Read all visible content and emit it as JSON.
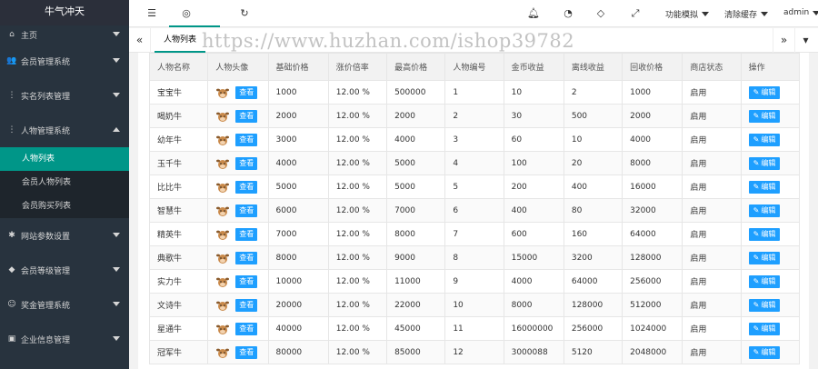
{
  "sidebar": {
    "brand": "牛气冲天",
    "items": [
      {
        "label": "主页",
        "icon": "home-icon",
        "glyph": "⌂"
      },
      {
        "label": "会员管理系统",
        "icon": "users-icon",
        "glyph": "👥"
      },
      {
        "label": "实名列表管理",
        "icon": "list-icon",
        "glyph": "⋮"
      },
      {
        "label": "人物管理系统",
        "icon": "list-icon",
        "glyph": "⋮"
      },
      {
        "label": "网站参数设置",
        "icon": "gear-icon",
        "glyph": "✱"
      },
      {
        "label": "会员等级管理",
        "icon": "diamond-icon",
        "glyph": "◆"
      },
      {
        "label": "奖金管理系统",
        "icon": "smile-icon",
        "glyph": "☺"
      },
      {
        "label": "企业信息管理",
        "icon": "document-icon",
        "glyph": "▣"
      }
    ],
    "sub_items": [
      "人物列表",
      "会员人物列表",
      "会员购买列表"
    ]
  },
  "topbar": {
    "menu_func": "功能模拟",
    "menu_cache": "清除缓存",
    "menu_user": "admin"
  },
  "tabs": {
    "active": "人物列表",
    "watermark": "https://www.huzhan.com/ishop39782"
  },
  "table": {
    "headers": [
      "人物名称",
      "人物头像",
      "基础价格",
      "涨价倍率",
      "最高价格",
      "人物编号",
      "金币收益",
      "离线收益",
      "回收价格",
      "商店状态",
      "操作"
    ],
    "view_label": "查看",
    "edit_label": "编辑",
    "rows": [
      {
        "name": "宝宝牛",
        "base": "1000",
        "rate": "12.00 %",
        "max": "500000",
        "no": "1",
        "gold": "10",
        "offline": "2",
        "recycle": "1000",
        "status": "启用"
      },
      {
        "name": "喝奶牛",
        "base": "2000",
        "rate": "12.00 %",
        "max": "2000",
        "no": "2",
        "gold": "30",
        "offline": "500",
        "recycle": "2000",
        "status": "启用"
      },
      {
        "name": "幼年牛",
        "base": "3000",
        "rate": "12.00 %",
        "max": "4000",
        "no": "3",
        "gold": "60",
        "offline": "10",
        "recycle": "4000",
        "status": "启用"
      },
      {
        "name": "玉千牛",
        "base": "4000",
        "rate": "12.00 %",
        "max": "5000",
        "no": "4",
        "gold": "100",
        "offline": "20",
        "recycle": "8000",
        "status": "启用"
      },
      {
        "name": "比比牛",
        "base": "5000",
        "rate": "12.00 %",
        "max": "5000",
        "no": "5",
        "gold": "200",
        "offline": "400",
        "recycle": "16000",
        "status": "启用"
      },
      {
        "name": "智慧牛",
        "base": "6000",
        "rate": "12.00 %",
        "max": "7000",
        "no": "6",
        "gold": "400",
        "offline": "80",
        "recycle": "32000",
        "status": "启用"
      },
      {
        "name": "精英牛",
        "base": "7000",
        "rate": "12.00 %",
        "max": "8000",
        "no": "7",
        "gold": "600",
        "offline": "160",
        "recycle": "64000",
        "status": "启用"
      },
      {
        "name": "典歌牛",
        "base": "8000",
        "rate": "12.00 %",
        "max": "9000",
        "no": "8",
        "gold": "15000",
        "offline": "3200",
        "recycle": "128000",
        "status": "启用"
      },
      {
        "name": "实力牛",
        "base": "10000",
        "rate": "12.00 %",
        "max": "11000",
        "no": "9",
        "gold": "4000",
        "offline": "64000",
        "recycle": "256000",
        "status": "启用"
      },
      {
        "name": "文诗牛",
        "base": "20000",
        "rate": "12.00 %",
        "max": "22000",
        "no": "10",
        "gold": "8000",
        "offline": "128000",
        "recycle": "512000",
        "status": "启用"
      },
      {
        "name": "星通牛",
        "base": "40000",
        "rate": "12.00 %",
        "max": "45000",
        "no": "11",
        "gold": "16000000",
        "offline": "256000",
        "recycle": "1024000",
        "status": "启用"
      },
      {
        "name": "冠军牛",
        "base": "80000",
        "rate": "12.00 %",
        "max": "85000",
        "no": "12",
        "gold": "3000088",
        "offline": "5120",
        "recycle": "2048000",
        "status": "启用"
      }
    ]
  },
  "colors": {
    "sidebar_bg": "#28333e",
    "active_green": "#009688",
    "button_blue": "#1E9FFF"
  }
}
